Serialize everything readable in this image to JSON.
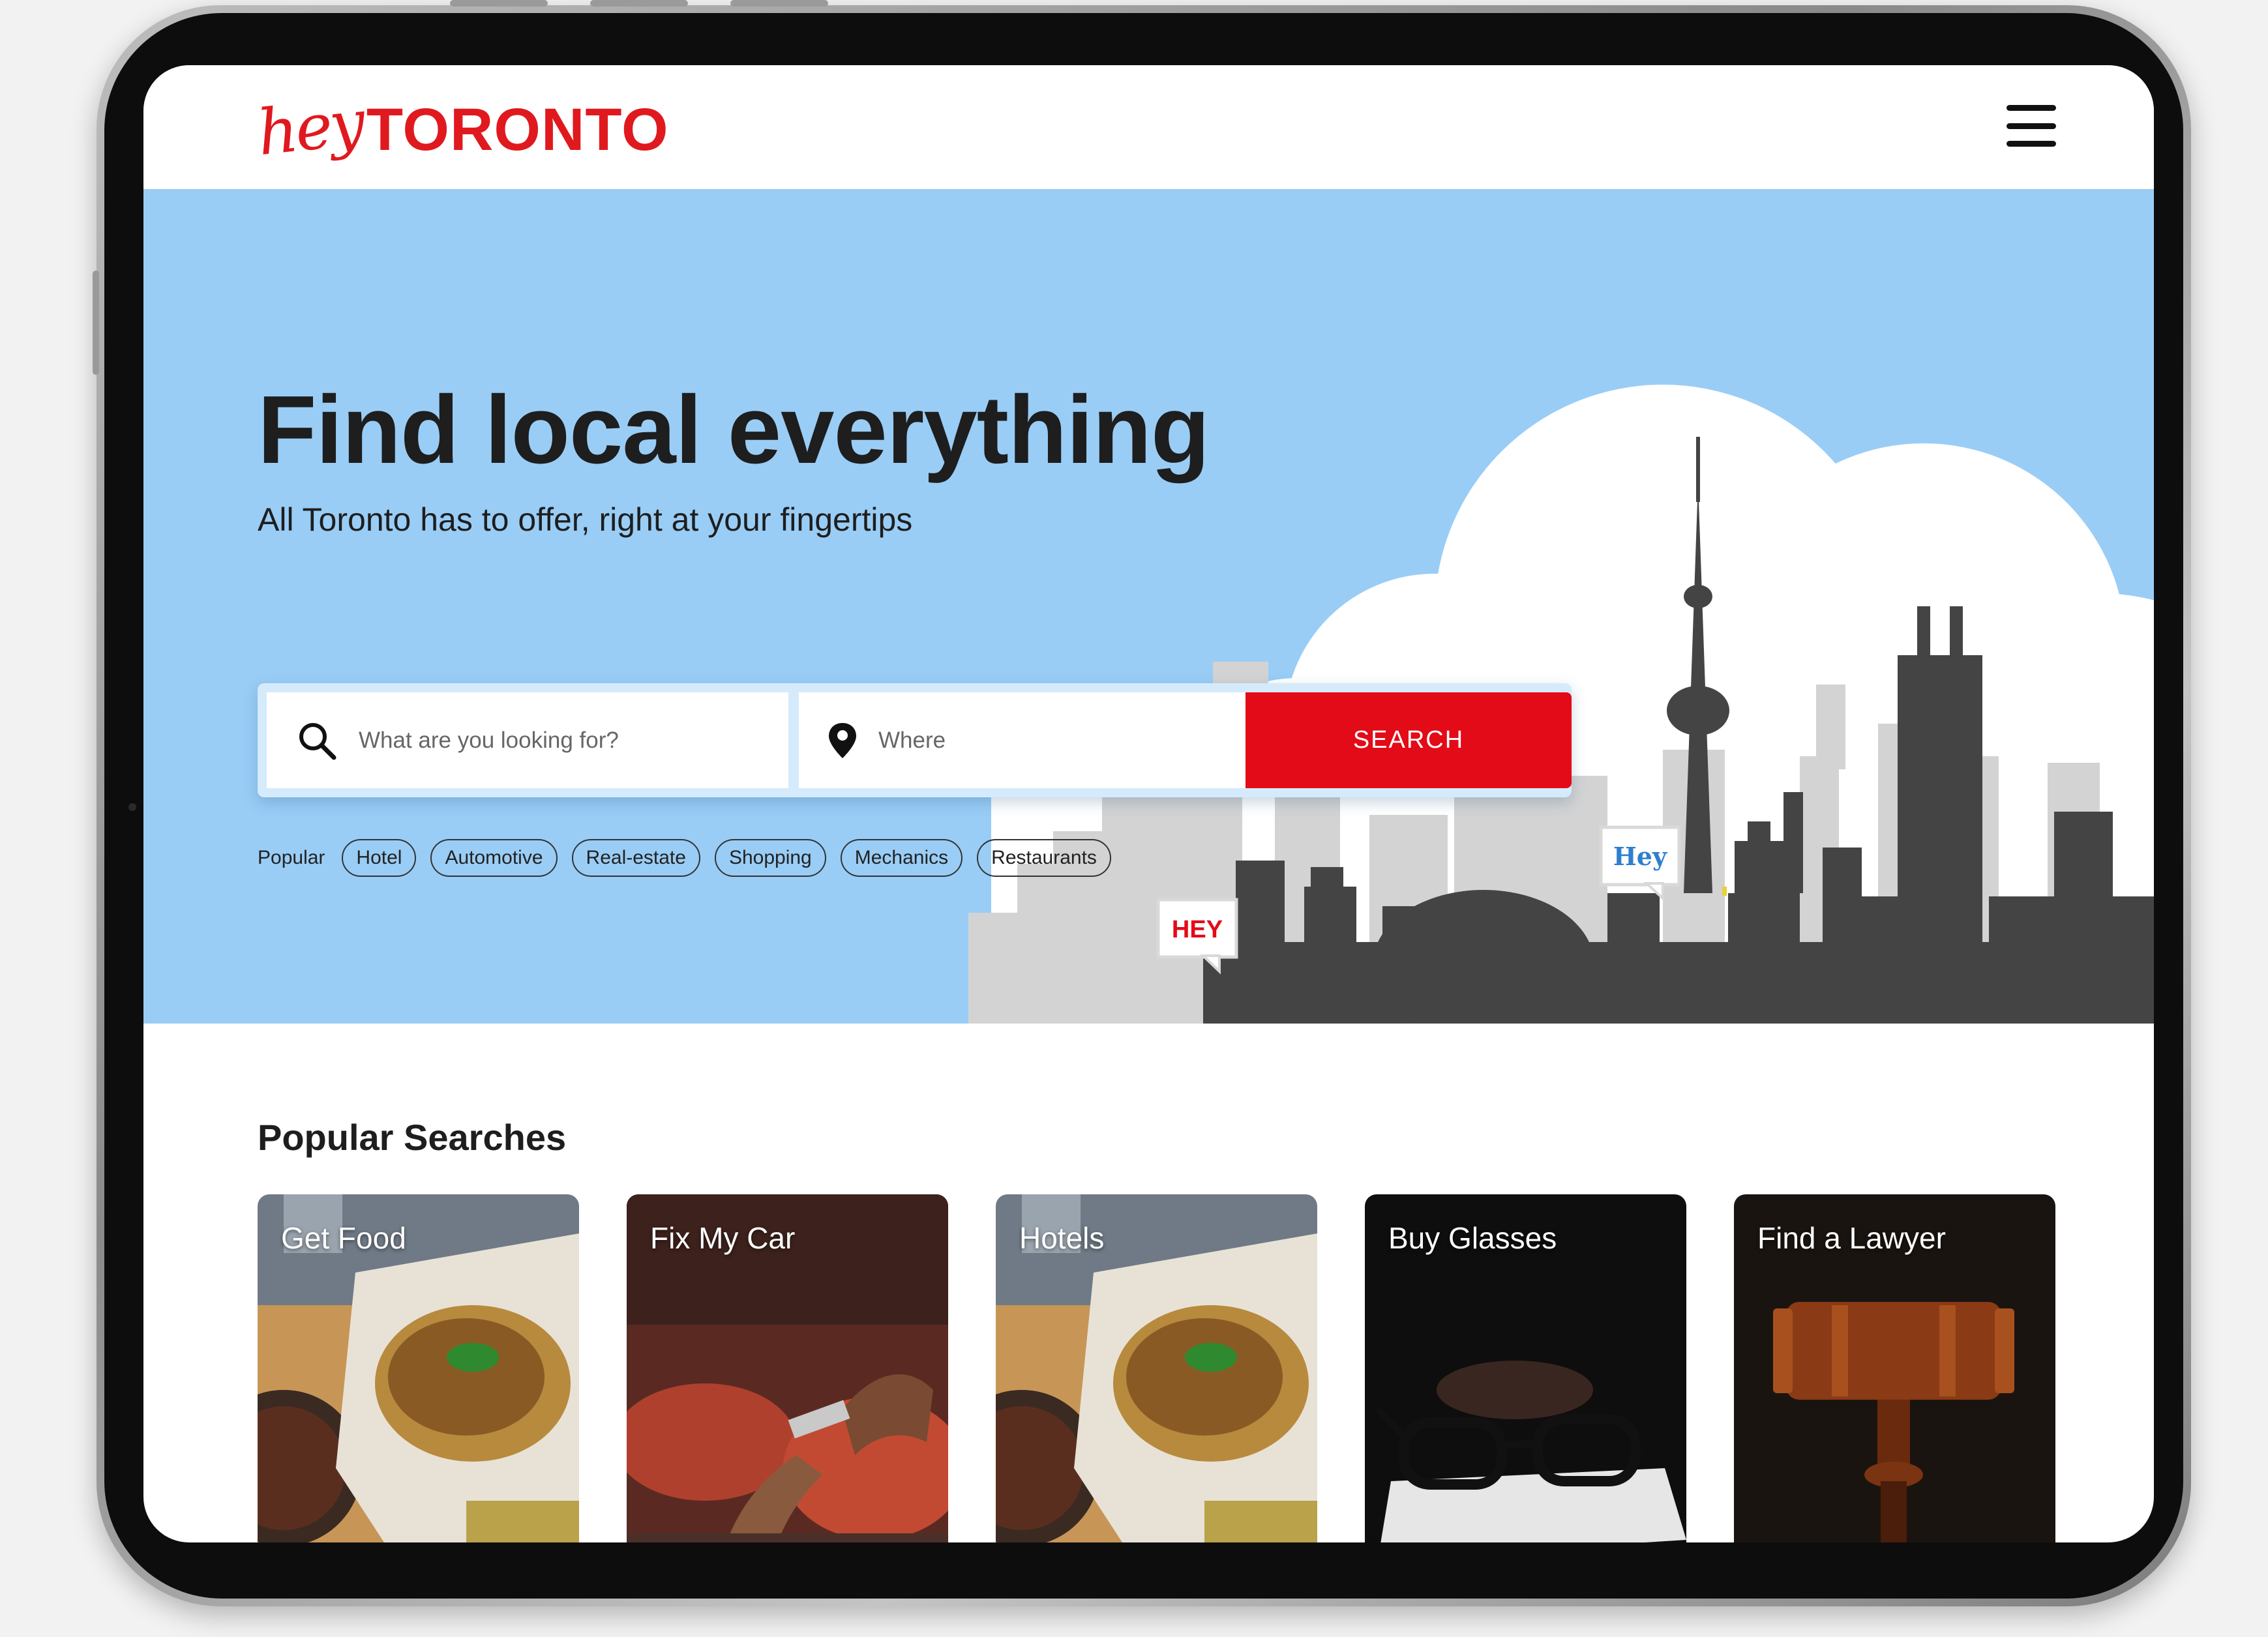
{
  "header": {
    "logo_script": "hey",
    "logo_word": "TORONTO",
    "menu_icon": "hamburger-menu-icon",
    "brand_color": "#e0191f"
  },
  "hero": {
    "title": "Find local everything",
    "subtitle": "All Toronto has to offer, right at your fingertips",
    "background_color": "#99cdf6",
    "bubble_left": "HEY",
    "bubble_right": "Hey"
  },
  "search": {
    "what_placeholder": "What are you looking for?",
    "where_placeholder": "Where",
    "button_label": "SEARCH",
    "button_color": "#e30b17",
    "what_icon": "search-icon",
    "where_icon": "location-pin-icon"
  },
  "popular": {
    "label": "Popular",
    "tags": [
      "Hotel",
      "Automotive",
      "Real-estate",
      "Shopping",
      "Mechanics",
      "Restaurants"
    ]
  },
  "popular_searches": {
    "title": "Popular Searches",
    "cards": [
      {
        "label": "Get Food"
      },
      {
        "label": "Fix My Car"
      },
      {
        "label": "Hotels"
      },
      {
        "label": "Buy Glasses"
      },
      {
        "label": "Find a Lawyer"
      }
    ]
  }
}
